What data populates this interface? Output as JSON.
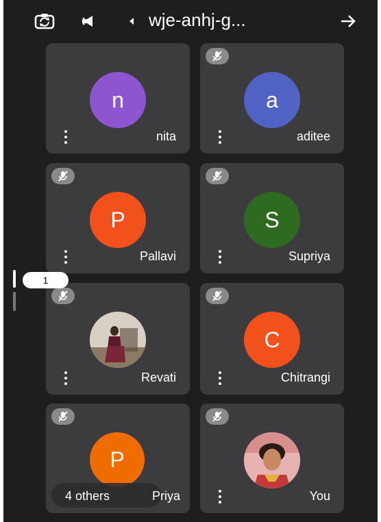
{
  "header": {
    "title": "wje-anhj-g...",
    "icons": [
      "switch-camera-icon",
      "speaker-icon",
      "caret-left-icon",
      "back-arrow-icon"
    ]
  },
  "participants": [
    {
      "name": "nita",
      "initial": "n",
      "color": "#8e55d1",
      "muted": false,
      "photo": false
    },
    {
      "name": "aditee",
      "initial": "a",
      "color": "#5062c4",
      "muted": true,
      "photo": false
    },
    {
      "name": "Pallavi",
      "initial": "P",
      "color": "#f2511b",
      "muted": true,
      "photo": false
    },
    {
      "name": "Supriya",
      "initial": "S",
      "color": "#2e6b21",
      "muted": true,
      "photo": false
    },
    {
      "name": "Revati",
      "initial": "",
      "color": "#b9a7a0",
      "muted": true,
      "photo": true
    },
    {
      "name": "Chitrangi",
      "initial": "C",
      "color": "#f2511b",
      "muted": true,
      "photo": false
    },
    {
      "name": "Priya",
      "initial": "P",
      "color": "#ef6c00",
      "muted": true,
      "photo": false
    },
    {
      "name": "You",
      "initial": "",
      "color": "#e8a9a9",
      "muted": true,
      "photo": true
    }
  ],
  "others_label": "4 others",
  "page_indicator": "1",
  "accent": "#1e1e1e"
}
